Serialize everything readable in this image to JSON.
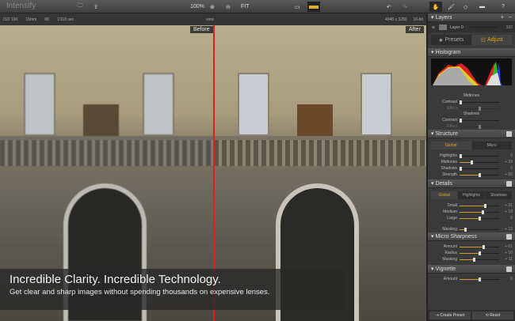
{
  "app": {
    "title": "Intensify"
  },
  "toolbar": {
    "zoom": "100%",
    "fit": "FIT",
    "open_icon": "folder-icon",
    "export_icon": "share-icon",
    "help": "?"
  },
  "info": {
    "iso": "ISO 100",
    "focal": "16mm",
    "aperture": "f/8",
    "shutter": "1/118 sec",
    "view": "view",
    "dimensions": "4948 x 3280",
    "bit": "16-bit"
  },
  "compare": {
    "before": "Before",
    "after": "After"
  },
  "caption": {
    "headline": "Incredible Clarity. Incredible Technology.",
    "sub": "Get clear and sharp images without spending thousands on expensive lenses."
  },
  "layers": {
    "title": "Layers",
    "layer": "Layer 0",
    "opacity": "100"
  },
  "panel_tabs": {
    "presets": "Presets",
    "adjust": "Adjust"
  },
  "histogram": {
    "title": "Histogram"
  },
  "tone": {
    "midtones": "Midtones",
    "shadows": "Shadows",
    "contrast": "Contrast",
    "effect": "Effect"
  },
  "structure": {
    "title": "Structure",
    "tabs": [
      "Global",
      "Micro"
    ],
    "sliders": [
      {
        "label": "Highlights",
        "value": "0",
        "pct": 0
      },
      {
        "label": "Midtones",
        "value": "+ 29",
        "pct": 29
      },
      {
        "label": "Shadows",
        "value": "0",
        "pct": 0
      },
      {
        "label": "Strength",
        "value": "+ 50",
        "pct": 50
      }
    ]
  },
  "details": {
    "title": "Details",
    "tabs": [
      "Global",
      "Highlights",
      "Shadows"
    ],
    "sliders": [
      {
        "label": "Small",
        "value": "+ 31",
        "pct": 65
      },
      {
        "label": "Medium",
        "value": "+ 18",
        "pct": 58
      },
      {
        "label": "Large",
        "value": "0",
        "pct": 50
      }
    ],
    "masking": {
      "label": "Masking",
      "value": "+ 13",
      "pct": 13
    }
  },
  "micro_sharpness": {
    "title": "Micro Sharpness",
    "sliders": [
      {
        "label": "Amount",
        "value": "+ 61",
        "pct": 61
      },
      {
        "label": "Radius",
        "value": "+ 10",
        "pct": 50
      },
      {
        "label": "Masking",
        "value": "+ 11",
        "pct": 35
      }
    ]
  },
  "vignette": {
    "title": "Vignette",
    "sliders": [
      {
        "label": "Amount",
        "value": "0",
        "pct": 50
      }
    ]
  },
  "footer": {
    "create_preset": "Create Preset",
    "reset": "Reset"
  },
  "colors": {
    "accent": "#d8a830",
    "divider": "#e02020"
  }
}
